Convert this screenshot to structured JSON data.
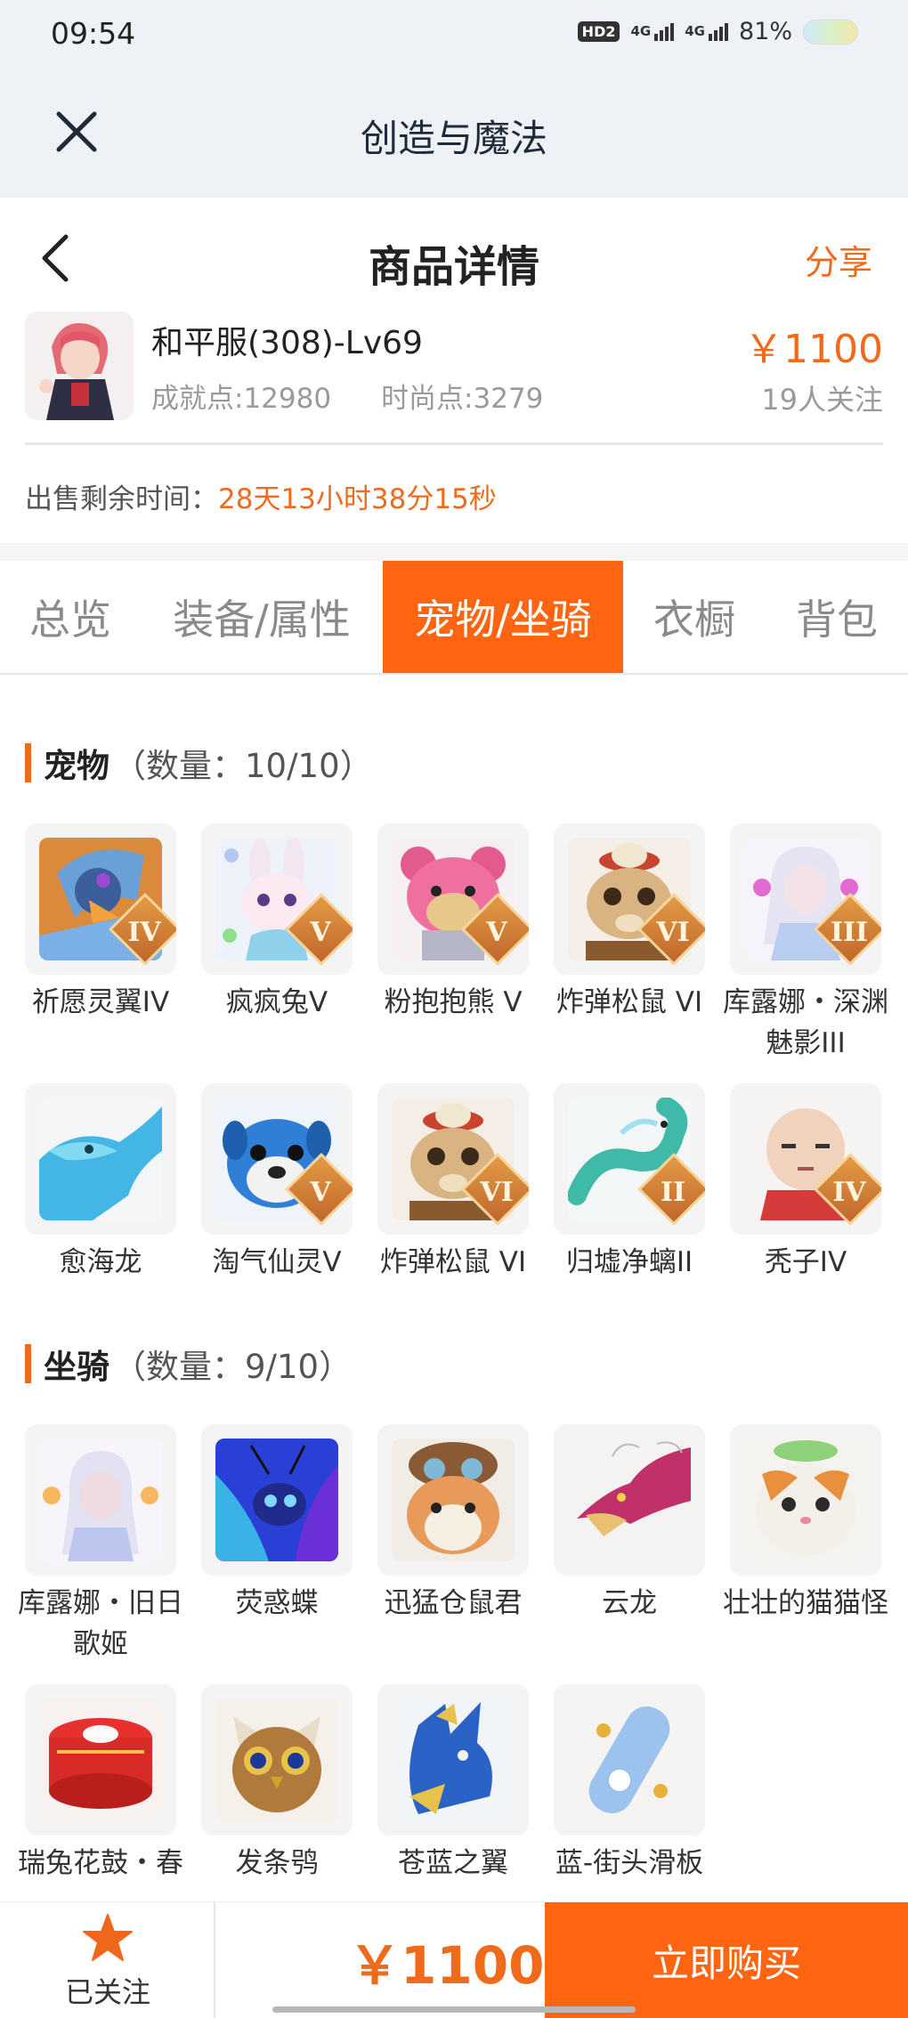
{
  "status": {
    "time": "09:54",
    "hd": "HD2",
    "net1": "4G",
    "net2": "4G",
    "battery": "81%"
  },
  "appbar": {
    "title": "创造与魔法"
  },
  "nav": {
    "title": "商品详情",
    "share": "分享"
  },
  "item": {
    "name": "和平服(308)-Lv69",
    "achievement": "成就点:12980",
    "fashion": "时尚点:3279",
    "price": "￥1100",
    "followers": "19人关注"
  },
  "sale": {
    "label": "出售剩余时间：",
    "value": "28天13小时38分15秒"
  },
  "tabs": [
    {
      "label": "总览"
    },
    {
      "label": "装备/属性"
    },
    {
      "label": "宠物/坐骑"
    },
    {
      "label": "衣橱"
    },
    {
      "label": "背包"
    }
  ],
  "active_tab": "宠物/坐骑",
  "pets": {
    "title": "宠物",
    "count": "（数量：10/10）",
    "items": [
      {
        "name": "祈愿灵翼IV",
        "rank": "IV"
      },
      {
        "name": "疯疯兔V",
        "rank": "V"
      },
      {
        "name": "粉抱抱熊 V",
        "rank": "V"
      },
      {
        "name": "炸弹松鼠 VI",
        "rank": "VI"
      },
      {
        "name": "库露娜・深渊魅影III",
        "rank": "III"
      },
      {
        "name": "愈海龙",
        "rank": ""
      },
      {
        "name": "淘气仙灵V",
        "rank": "V"
      },
      {
        "name": "炸弹松鼠 VI",
        "rank": "VI"
      },
      {
        "name": "归墟净螭II",
        "rank": "II"
      },
      {
        "name": "秃子IV",
        "rank": "IV"
      }
    ]
  },
  "mounts": {
    "title": "坐骑",
    "count": "（数量：9/10）",
    "items": [
      {
        "name": "库露娜・旧日歌姬"
      },
      {
        "name": "荧惑蝶"
      },
      {
        "name": "迅猛仓鼠君"
      },
      {
        "name": "云龙"
      },
      {
        "name": "壮壮的猫猫怪"
      },
      {
        "name": "瑞兔花鼓・春"
      },
      {
        "name": "发条鸮"
      },
      {
        "name": "苍蓝之翼"
      },
      {
        "name": "蓝-街头滑板"
      }
    ]
  },
  "bottom": {
    "follow_label": "已关注",
    "price": "￥1100",
    "buy_label": "立即购买"
  },
  "colors": {
    "accent": "#ff6410",
    "price": "#f06a1b"
  }
}
